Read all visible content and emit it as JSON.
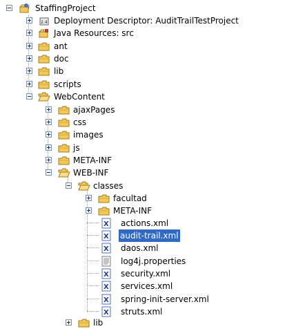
{
  "tree": {
    "project": "StaffingProject",
    "deployment_descriptor": "Deployment Descriptor: AuditTrailTestProject",
    "java_resources": "Java Resources: src",
    "ant": "ant",
    "doc": "doc",
    "lib": "lib",
    "scripts": "scripts",
    "webcontent": "WebContent",
    "ajaxpages": "ajaxPages",
    "css": "css",
    "images": "images",
    "js": "js",
    "meta_inf": "META-INF",
    "web_inf": "WEB-INF",
    "classes": "classes",
    "facultad": "facultad",
    "classes_meta_inf": "META-INF",
    "actions_xml": "actions.xml",
    "audit_trail_xml": "audit-trail.xml",
    "daos_xml": "daos.xml",
    "log4j_properties": "log4j.properties",
    "security_xml": "security.xml",
    "services_xml": "services.xml",
    "spring_init_server_xml": "spring-init-server.xml",
    "struts_xml": "struts.xml",
    "web_inf_lib": "lib"
  },
  "selected_item": "audit-trail.xml",
  "colors": {
    "selection": "#316ac5",
    "folder": "#f3c85a",
    "xml_icon": "#4b6fb8"
  }
}
